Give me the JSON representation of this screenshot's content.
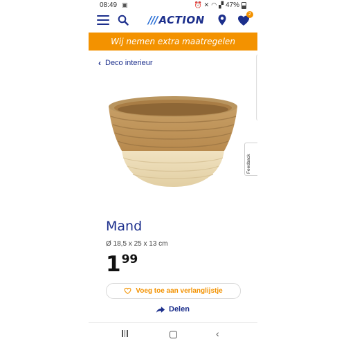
{
  "status_bar": {
    "time": "08:49",
    "left_icon": "screenshot-icon",
    "battery": "47%",
    "icons": [
      "alarm-icon",
      "mute-icon",
      "wifi-icon",
      "signal-icon",
      "battery-icon"
    ]
  },
  "header": {
    "logo_slashes": "///",
    "logo_text": "ACTION",
    "wishlist_count": "2",
    "icons": [
      "menu-icon",
      "search-icon",
      "location-pin-icon",
      "heart-icon"
    ]
  },
  "banner": {
    "text": "Wij nemen extra maatregelen"
  },
  "breadcrumb": {
    "label": "Deco interieur"
  },
  "feedback": {
    "label": "Feedback"
  },
  "product": {
    "title": "Mand",
    "dimensions": "Ø 18,5 x 25 x 13 cm",
    "price_whole": "1",
    "price_cents": "99",
    "wishlist_label": "Voeg toe aan verlanglijstje",
    "share_label": "Delen"
  },
  "colors": {
    "brand_blue": "#1c2f8c",
    "accent_orange": "#f39200",
    "banner_text": "#ffffff"
  }
}
